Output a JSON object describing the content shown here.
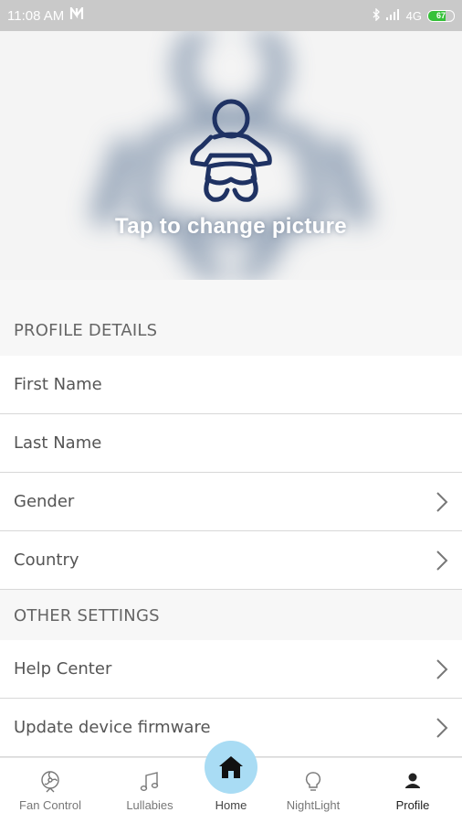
{
  "status_bar": {
    "time": "11:08 AM",
    "network": "4G",
    "battery_level": 67,
    "battery_text": "67"
  },
  "hero": {
    "caption": "Tap to change picture",
    "icon": "baby-icon"
  },
  "sections": [
    {
      "title": "PROFILE DETAILS",
      "items": [
        {
          "label": "First Name",
          "chevron": false
        },
        {
          "label": "Last Name",
          "chevron": false
        },
        {
          "label": "Gender",
          "chevron": true
        },
        {
          "label": "Country",
          "chevron": true
        }
      ]
    },
    {
      "title": "OTHER SETTINGS",
      "items": [
        {
          "label": "Help Center",
          "chevron": true
        },
        {
          "label": "Update device firmware",
          "chevron": true
        }
      ]
    }
  ],
  "nav": {
    "items": [
      {
        "label": "Fan Control",
        "icon": "fan-icon"
      },
      {
        "label": "Lullabies",
        "icon": "music-note-icon"
      },
      {
        "label": "Home",
        "icon": "home-icon"
      },
      {
        "label": "NightLight",
        "icon": "lightbulb-icon"
      },
      {
        "label": "Profile",
        "icon": "person-icon"
      }
    ],
    "active": "Profile"
  },
  "colors": {
    "accent": "#a9dcf4",
    "icon_navy": "#1f3263",
    "battery": "#36c13a"
  }
}
